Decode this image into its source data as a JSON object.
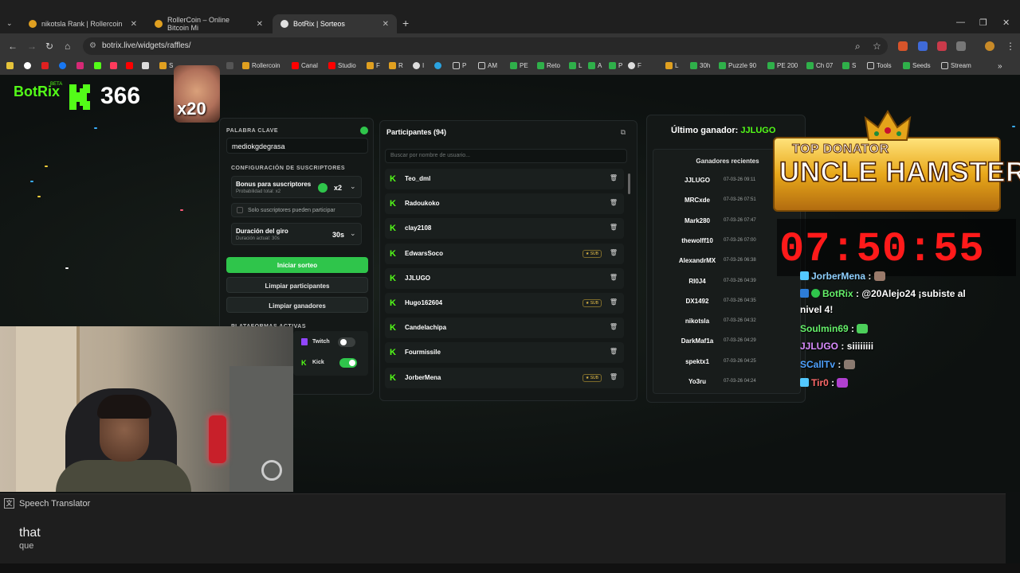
{
  "browser": {
    "tabs": [
      {
        "title": "nikotsla Rank | Rollercoin",
        "close": "✕"
      },
      {
        "title": "RollerCoin – Online Bitcoin Mi",
        "close": "✕"
      },
      {
        "title": "BotRix | Sorteos",
        "close": "✕"
      }
    ],
    "new_tab": "+",
    "url": "botrix.live/widgets/raffles/",
    "bookmarks": [
      "S",
      "Rollercoin",
      "Canal",
      "Studio",
      "F",
      "R",
      "I",
      "P",
      "AM",
      "PE",
      "Reto",
      "L",
      "A",
      "P",
      "F",
      "L",
      "30h",
      "Puzzle 90",
      "PE 200",
      "Ch 07",
      "S",
      "Tools",
      "Seeds",
      "Stream"
    ],
    "bookmarks_more": "»"
  },
  "stream_overlay": {
    "logo": "BotRix",
    "logo_beta": "BETA",
    "kick_count": "366",
    "multiplier": "x20"
  },
  "raffle_settings": {
    "keyword_label": "PALABRA CLAVE",
    "keyword_value": "mediokgdegrasa",
    "subscribers_section": "CONFIGURACIÓN DE SUSCRIPTORES",
    "bonus_title": "Bonus para suscriptores",
    "bonus_sub": "Probabilidad total: x2",
    "bonus_value": "x2",
    "only_subs_label": "Solo suscriptores pueden participar",
    "duration_title": "Duración del giro",
    "duration_sub": "Duración actual: 30s",
    "duration_value": "30s",
    "start_button": "Iniciar sorteo",
    "clear_participants_button": "Limpiar participantes",
    "clear_winners_button": "Limpiar ganadores",
    "platforms_label": "PLATAFORMAS ACTIVAS",
    "platforms": [
      {
        "name": "Twitch",
        "enabled": false
      },
      {
        "name": "Kick",
        "enabled": true
      }
    ]
  },
  "participants": {
    "title": "Participantes (94)",
    "search_placeholder": "Buscar por nombre de usuario...",
    "sub_badge": "★ SUB",
    "list": [
      {
        "name": "Teo_dml",
        "sub": false
      },
      {
        "name": "Radoukoko",
        "sub": false
      },
      {
        "name": "clay2108",
        "sub": false
      },
      {
        "name": "EdwarsSoco",
        "sub": true
      },
      {
        "name": "JJLUGO",
        "sub": false
      },
      {
        "name": "Hugo162604",
        "sub": true
      },
      {
        "name": "Candelachipa",
        "sub": false
      },
      {
        "name": "Fourmissile",
        "sub": false
      },
      {
        "name": "JorberMena",
        "sub": true
      }
    ]
  },
  "winners": {
    "last_winner_label": "Último ganador:",
    "last_winner": "JJLUGO",
    "recent_title": "Ganadores recientes",
    "recent": [
      {
        "name": "JJLUGO",
        "time": "07-03-26 09:11"
      },
      {
        "name": "MRCxde",
        "time": "07-03-26 07:51"
      },
      {
        "name": "Mark280",
        "time": "07-03-26 07:47"
      },
      {
        "name": "thewolff10",
        "time": "07-03-26 07:00"
      },
      {
        "name": "AlexandrMX",
        "time": "07-03-26 06:38"
      },
      {
        "name": "RI0J4",
        "time": "07-03-26 04:39"
      },
      {
        "name": "DX1492",
        "time": "07-03-26 04:35"
      },
      {
        "name": "nikotsla",
        "time": "07-03-26 04:32"
      },
      {
        "name": "DarkMaf1a",
        "time": "07-03-26 04:29"
      },
      {
        "name": "spektx1",
        "time": "07-03-26 04:25"
      },
      {
        "name": "Yo3ru",
        "time": "07-03-26 04:24"
      }
    ]
  },
  "donator": {
    "top_label": "TOP DONATOR",
    "name": "UNCLE HAMSTER"
  },
  "timer": "07:50:55",
  "chat": [
    {
      "user": "JorberMena",
      "msg": ":"
    },
    {
      "user": "BotRix",
      "msg": ": @20Alejo24 ¡subiste al"
    },
    {
      "user": "",
      "msg": "nivel 4!"
    },
    {
      "user": "Soulmin69",
      "msg": ":"
    },
    {
      "user": "JJLUGO",
      "msg": ": siiiiiiii"
    },
    {
      "user": "SCallTv",
      "msg": ":"
    },
    {
      "user": "Tir0",
      "msg": ":"
    }
  ],
  "translator": {
    "title": "Speech Translator",
    "text": "that",
    "translation": "que"
  }
}
